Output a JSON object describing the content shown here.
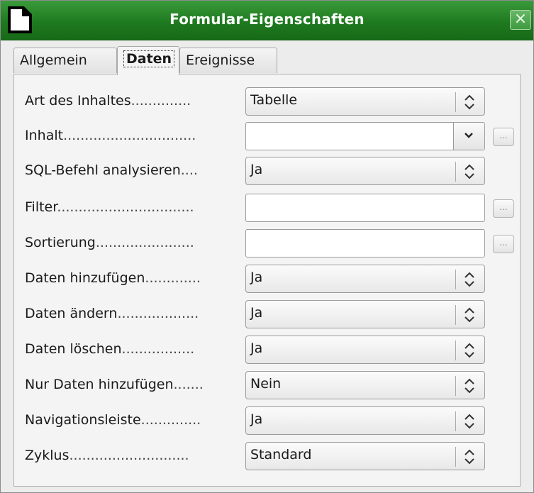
{
  "window": {
    "title": "Formular-Eigenschaften",
    "close_glyph": "×",
    "accent": "#1f7a1f"
  },
  "tabs": [
    {
      "label": "Allgemein",
      "active": false
    },
    {
      "label": "Daten",
      "active": true
    },
    {
      "label": "Ereignisse",
      "active": false
    }
  ],
  "fields": {
    "art": {
      "label": "Art des Inhaltes",
      "dots": "..............",
      "value": "Tabelle"
    },
    "inhalt": {
      "label": "Inhalt",
      "dots": "...............................",
      "value": ""
    },
    "sql": {
      "label": "SQL-Befehl analysieren",
      "dots": "....",
      "value": "Ja"
    },
    "filter": {
      "label": "Filter",
      "dots": "................................",
      "value": ""
    },
    "sortierung": {
      "label": "Sortierung",
      "dots": ".......................",
      "value": ""
    },
    "hinzufuegen": {
      "label": "Daten hinzufügen",
      "dots": ".............",
      "value": "Ja"
    },
    "aendern": {
      "label": "Daten ändern",
      "dots": "...................",
      "value": "Ja"
    },
    "loeschen": {
      "label": "Daten löschen",
      "dots": ".................",
      "value": "Ja"
    },
    "nur_hinzufuegen": {
      "label": "Nur Daten hinzufügen",
      "dots": ".......",
      "value": "Nein"
    },
    "navigation": {
      "label": "Navigationsleiste",
      "dots": "..............",
      "value": "Ja"
    },
    "zyklus": {
      "label": "Zyklus",
      "dots": "............................",
      "value": "Standard"
    }
  },
  "browse_button_label": "..."
}
